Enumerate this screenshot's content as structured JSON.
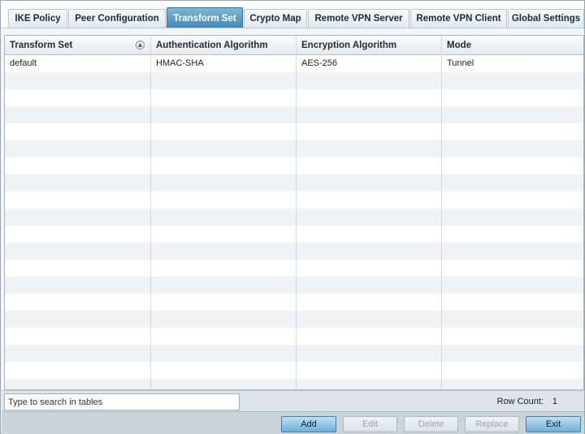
{
  "tabs": [
    {
      "label": "IKE Policy",
      "active": false
    },
    {
      "label": "Peer Configuration",
      "active": false
    },
    {
      "label": "Transform Set",
      "active": true
    },
    {
      "label": "Crypto Map",
      "active": false
    },
    {
      "label": "Remote VPN Server",
      "active": false
    },
    {
      "label": "Remote VPN Client",
      "active": false
    },
    {
      "label": "Global Settings",
      "active": false
    }
  ],
  "table": {
    "columns": [
      "Transform Set",
      "Authentication Algorithm",
      "Encryption Algorithm",
      "Mode"
    ],
    "rows": [
      [
        "default",
        "HMAC-SHA",
        "AES-256",
        "Tunnel"
      ]
    ],
    "sort_icon": "sort-circle-icon"
  },
  "search": {
    "placeholder": "Type to search in tables",
    "value": ""
  },
  "row_count": {
    "label": "Row  Count:",
    "value": "1"
  },
  "buttons": {
    "add": "Add",
    "edit": "Edit",
    "delete": "Delete",
    "replace": "Replace",
    "exit": "Exit"
  },
  "colors": {
    "active_tab": "#3f88b7",
    "primary_button": "#6fb0d8"
  }
}
